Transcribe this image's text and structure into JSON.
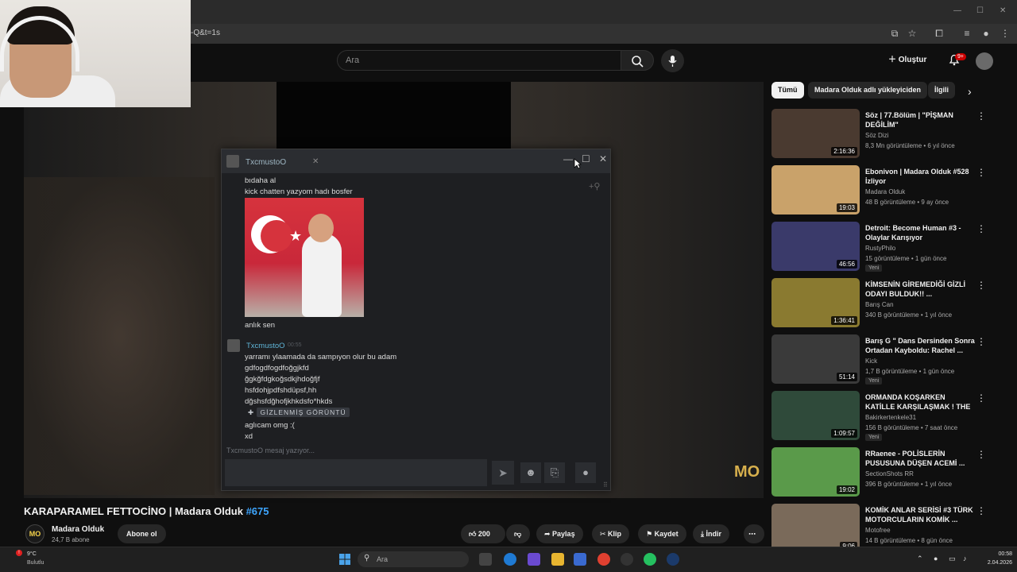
{
  "browser": {
    "url_fragment": "-Q&t=1s"
  },
  "yt_header": {
    "search_placeholder": "Ara",
    "create_label": "Oluştur",
    "notification_count": "9+"
  },
  "chat": {
    "tab_name": "TxcmustoO",
    "messages_top": [
      "bıdaha al",
      "kick chatten yazyom hadı bosfer"
    ],
    "after_image": "anlık sen",
    "sender2_name": "TxcmustoO",
    "sender2_time": "00:55",
    "messages_bottom": [
      "yarramı ylaamada da sampıyon olur bu adam",
      "gdfogdfogdfoğgjkfd",
      "ğgkğfdgkoğsdkjhdoğfjf",
      "hsfdohjpdfshdüpsf,hh",
      "dğshsfdğhofjkhkdsfo*hkds"
    ],
    "hidden_label": "GİZLENMİŞ GÖRÜNTÜ",
    "messages_tail": [
      "aglıcam omg :(",
      "xd"
    ],
    "typing_text": "TxcmustoO mesaj yazıyor..."
  },
  "sidebar": {
    "chips": [
      "Tümü",
      "Madara Olduk adlı yükleyiciden",
      "İlgili"
    ],
    "recommendations": [
      {
        "title": "Söz | 77.Bölüm | \"PİŞMAN DEĞİLİM\"",
        "channel": "Söz Dizi",
        "meta": "8,3 Mn görüntüleme • 6 yıl önce",
        "duration": "2:16:36",
        "badge": "",
        "thumb_color": "#4a3a30"
      },
      {
        "title": "Ebonivon | Madara Olduk #528 İzliyor",
        "channel": "Madara Olduk",
        "meta": "48 B görüntüleme • 9 ay önce",
        "duration": "19:03",
        "badge": "",
        "thumb_color": "#c9a26a"
      },
      {
        "title": "Detroit: Become Human #3 - Olaylar Karışıyor",
        "channel": "RustyPhilo",
        "meta": "15 görüntüleme • 1 gün önce",
        "duration": "46:56",
        "badge": "Yeni",
        "thumb_color": "#3a3a6a"
      },
      {
        "title": "KİMSENİN GİREMEDİĞİ GİZLİ ODAYI BULDUK!! ...",
        "channel": "Barış Can",
        "meta": "340 B görüntüleme • 1 yıl önce",
        "duration": "1:36:41",
        "badge": "",
        "thumb_color": "#8a7a30"
      },
      {
        "title": "Barış G \" Dans Dersinden Sonra Ortadan Kayboldu: Rachel ...",
        "channel": "Kick",
        "meta": "1,7 B görüntüleme • 1 gün önce",
        "duration": "51:14",
        "badge": "Yeni",
        "thumb_color": "#3a3a3a"
      },
      {
        "title": "ORMANDA KOŞARKEN KATİLLE KARŞILAŞMAK ! THE RUN",
        "channel": "Bakirkertenkele31",
        "meta": "156 B görüntüleme • 7 saat önce",
        "duration": "1:09:57",
        "badge": "Yeni",
        "thumb_color": "#2f4a3a"
      },
      {
        "title": "RRaenee - POLİSLERİN PUSUSUNA DÜŞEN ACEMİ ...",
        "channel": "SectionShots RR",
        "meta": "396 B görüntüleme • 1 yıl önce",
        "duration": "19:02",
        "badge": "",
        "thumb_color": "#5a9a4a"
      },
      {
        "title": "KOMİK ANLAR SERİSİ #3 TÜRK MOTORCULARIN KOMİK ...",
        "channel": "Motofree",
        "meta": "14 B görüntüleme • 8 gün önce",
        "duration": "9:06",
        "badge": "",
        "thumb_color": "#7a6a5a"
      }
    ]
  },
  "video": {
    "title": "KARAPARAMEL FETTOCİNO | Madara Olduk",
    "episode": "#675",
    "watermark": "MO",
    "channel_name": "Madara Olduk",
    "channel_subs": "24,7 B abone",
    "channel_initials": "MO",
    "subscribe_label": "Abone ol",
    "likes": "200",
    "share_label": "Paylaş",
    "clip_label": "Klip",
    "save_label": "Kaydet",
    "download_label": "İndir"
  },
  "taskbar": {
    "weather_temp": "9°C",
    "weather_desc": "Bulutlu",
    "search_placeholder": "Ara",
    "time": "00:58",
    "date": "2.04.2026"
  }
}
